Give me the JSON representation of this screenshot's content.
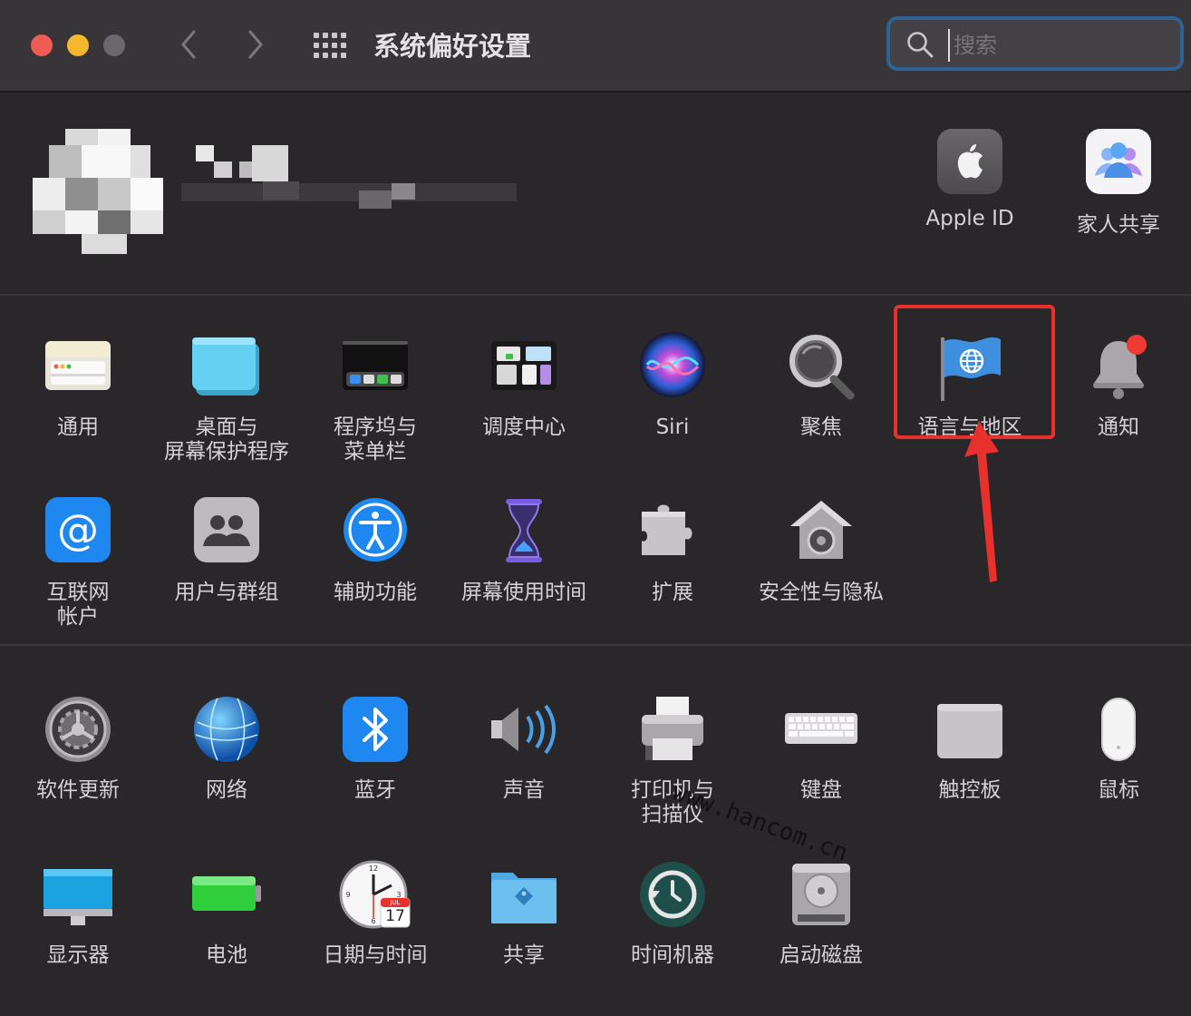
{
  "window": {
    "title": "系统偏好设置",
    "colors": {
      "close": "#ee5c54",
      "minimize": "#f5b72e",
      "zoom": "#6b686c",
      "accent": "#2e6293"
    }
  },
  "search": {
    "placeholder": "搜索",
    "value": ""
  },
  "account": {
    "items": [
      {
        "label": "Apple ID",
        "icon": "apple-logo-icon"
      },
      {
        "label": "家人共享",
        "icon": "family-sharing-icon"
      }
    ]
  },
  "section2": {
    "panes": [
      {
        "label": "通用",
        "icon": "general-icon"
      },
      {
        "label": "桌面与\n屏幕保护程序",
        "icon": "desktop-icon"
      },
      {
        "label": "程序坞与\n菜单栏",
        "icon": "dock-icon"
      },
      {
        "label": "调度中心",
        "icon": "mission-control-icon"
      },
      {
        "label": "Siri",
        "icon": "siri-icon"
      },
      {
        "label": "聚焦",
        "icon": "spotlight-icon"
      },
      {
        "label": "语言与地区",
        "icon": "language-region-flag-icon"
      },
      {
        "label": "通知",
        "icon": "notifications-bell-icon"
      },
      {
        "label": "互联网\n帐户",
        "icon": "internet-accounts-at-icon"
      },
      {
        "label": "用户与群组",
        "icon": "users-groups-icon"
      },
      {
        "label": "辅助功能",
        "icon": "accessibility-icon"
      },
      {
        "label": "屏幕使用时间",
        "icon": "screen-time-hourglass-icon"
      },
      {
        "label": "扩展",
        "icon": "extensions-puzzle-icon"
      },
      {
        "label": "安全性与隐私",
        "icon": "security-house-icon"
      }
    ]
  },
  "section3": {
    "panes": [
      {
        "label": "软件更新",
        "icon": "software-update-gear-icon"
      },
      {
        "label": "网络",
        "icon": "network-globe-icon"
      },
      {
        "label": "蓝牙",
        "icon": "bluetooth-icon"
      },
      {
        "label": "声音",
        "icon": "sound-speaker-icon"
      },
      {
        "label": "打印机与\n扫描仪",
        "icon": "printer-icon"
      },
      {
        "label": "键盘",
        "icon": "keyboard-icon"
      },
      {
        "label": "触控板",
        "icon": "trackpad-icon"
      },
      {
        "label": "鼠标",
        "icon": "mouse-icon"
      },
      {
        "label": "显示器",
        "icon": "display-icon"
      },
      {
        "label": "电池",
        "icon": "battery-icon"
      },
      {
        "label": "日期与时间",
        "icon": "date-time-clock-icon"
      },
      {
        "label": "共享",
        "icon": "sharing-folder-icon"
      },
      {
        "label": "时间机器",
        "icon": "time-machine-icon"
      },
      {
        "label": "启动磁盘",
        "icon": "startup-disk-icon"
      }
    ]
  },
  "calendar": {
    "month": "JUL",
    "day": "17"
  },
  "watermark": "www.hancom.cn"
}
